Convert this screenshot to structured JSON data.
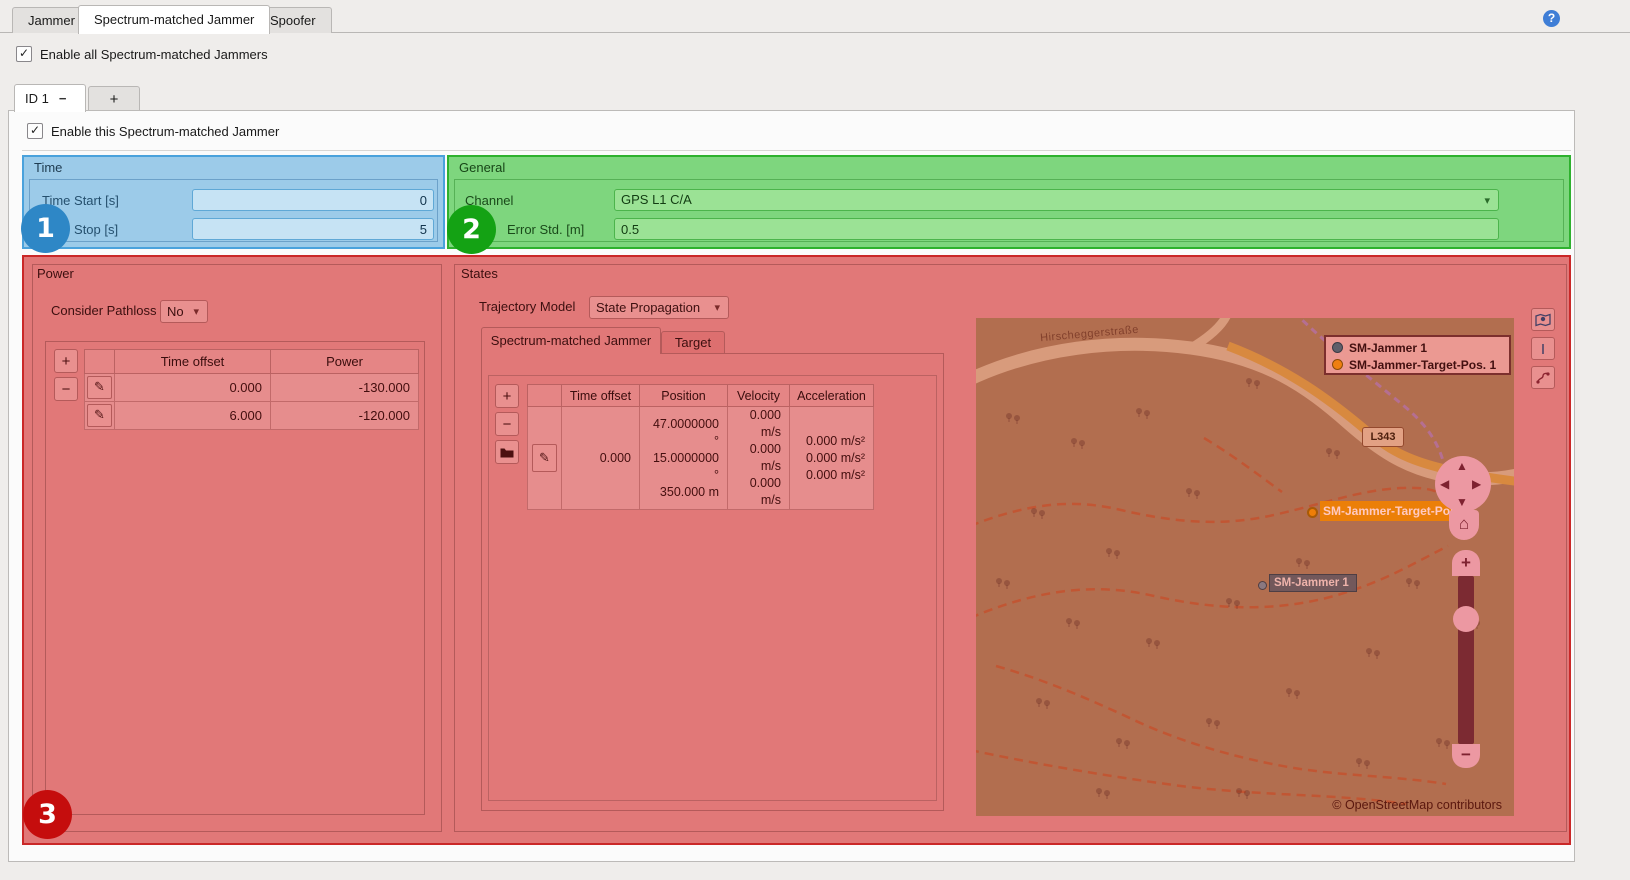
{
  "app": {
    "help_icon": "?"
  },
  "top_tabs": {
    "items": [
      "Jammer",
      "Spectrum-matched Jammer",
      "Spoofer"
    ],
    "active_index": 1
  },
  "enable_all": {
    "label": "Enable all Spectrum-matched Jammers",
    "checked": true
  },
  "instance_tabs": {
    "active_label": "ID 1",
    "detach_glyph": "−",
    "add_label": "+"
  },
  "enable_this": {
    "label": "Enable this Spectrum-matched Jammer",
    "checked": true
  },
  "annotations": {
    "badge_1": "1",
    "badge_2": "2",
    "badge_3": "3"
  },
  "time": {
    "title": "Time",
    "start_label": "Time Start [s]",
    "start_value": "0",
    "stop_label": "Time Stop [s]",
    "stop_value": "5"
  },
  "general": {
    "title": "General",
    "channel_label": "Channel",
    "channel_value": "GPS L1 C/A",
    "error_std_label": "Error Std. [m]",
    "error_std_value": "0.5"
  },
  "power": {
    "title": "Power",
    "pathloss_label": "Consider Pathloss",
    "pathloss_value": "No",
    "table": {
      "headers": [
        "Time offset",
        "Power"
      ],
      "rows": [
        {
          "time_offset": "0.000",
          "power": "-130.000"
        },
        {
          "time_offset": "6.000",
          "power": "-120.000"
        }
      ]
    }
  },
  "states": {
    "title": "States",
    "trajectory_label": "Trajectory Model",
    "trajectory_value": "State Propagation",
    "tabs": [
      "Spectrum-matched Jammer",
      "Target"
    ],
    "table": {
      "headers": [
        "Time offset",
        "Position",
        "Velocity",
        "Acceleration"
      ],
      "row": {
        "time_offset": "0.000",
        "position": [
          "47.0000000 °",
          "15.0000000 °",
          "350.000 m"
        ],
        "velocity": [
          "0.000 m/s",
          "0.000 m/s",
          "0.000 m/s"
        ],
        "acceleration": [
          "0.000 m/s²",
          "0.000 m/s²",
          "0.000 m/s²"
        ]
      }
    }
  },
  "map": {
    "legend": [
      {
        "label": "SM-Jammer 1",
        "color": "#5f5f6a"
      },
      {
        "label": "SM-Jammer-Target-Pos. 1",
        "color": "#ee7f10"
      }
    ],
    "markers": [
      {
        "label": "SM-Jammer 1"
      },
      {
        "label": "SM-Jammer-Target-Pos. 1"
      }
    ],
    "street_label": "Hirscheggerstraße",
    "road_ref": "L343",
    "attribution": "© OpenStreetMap contributors"
  },
  "icons": {
    "check": "✓",
    "dropdown": "▾",
    "plus": "+",
    "minus": "−",
    "edit": "✎",
    "home": "⌂",
    "pan_up": "▲",
    "pan_down": "▼",
    "pan_left": "◀",
    "pan_right": "▶"
  },
  "colors": {
    "time_overlay": "#9ccbe9",
    "time_border": "#4aa2dc",
    "badge_1": "#2e87c6",
    "general_overlay": "#7ed67e",
    "general_border": "#2eb12e",
    "badge_2": "#14a214",
    "power_states_overlay": "#e17878",
    "power_states_border": "#ca2828",
    "badge_3": "#c50d0d",
    "marker_target": "#ee7f10",
    "marker_jammer": "#5f5f6a",
    "help": "#3f7ed6"
  }
}
